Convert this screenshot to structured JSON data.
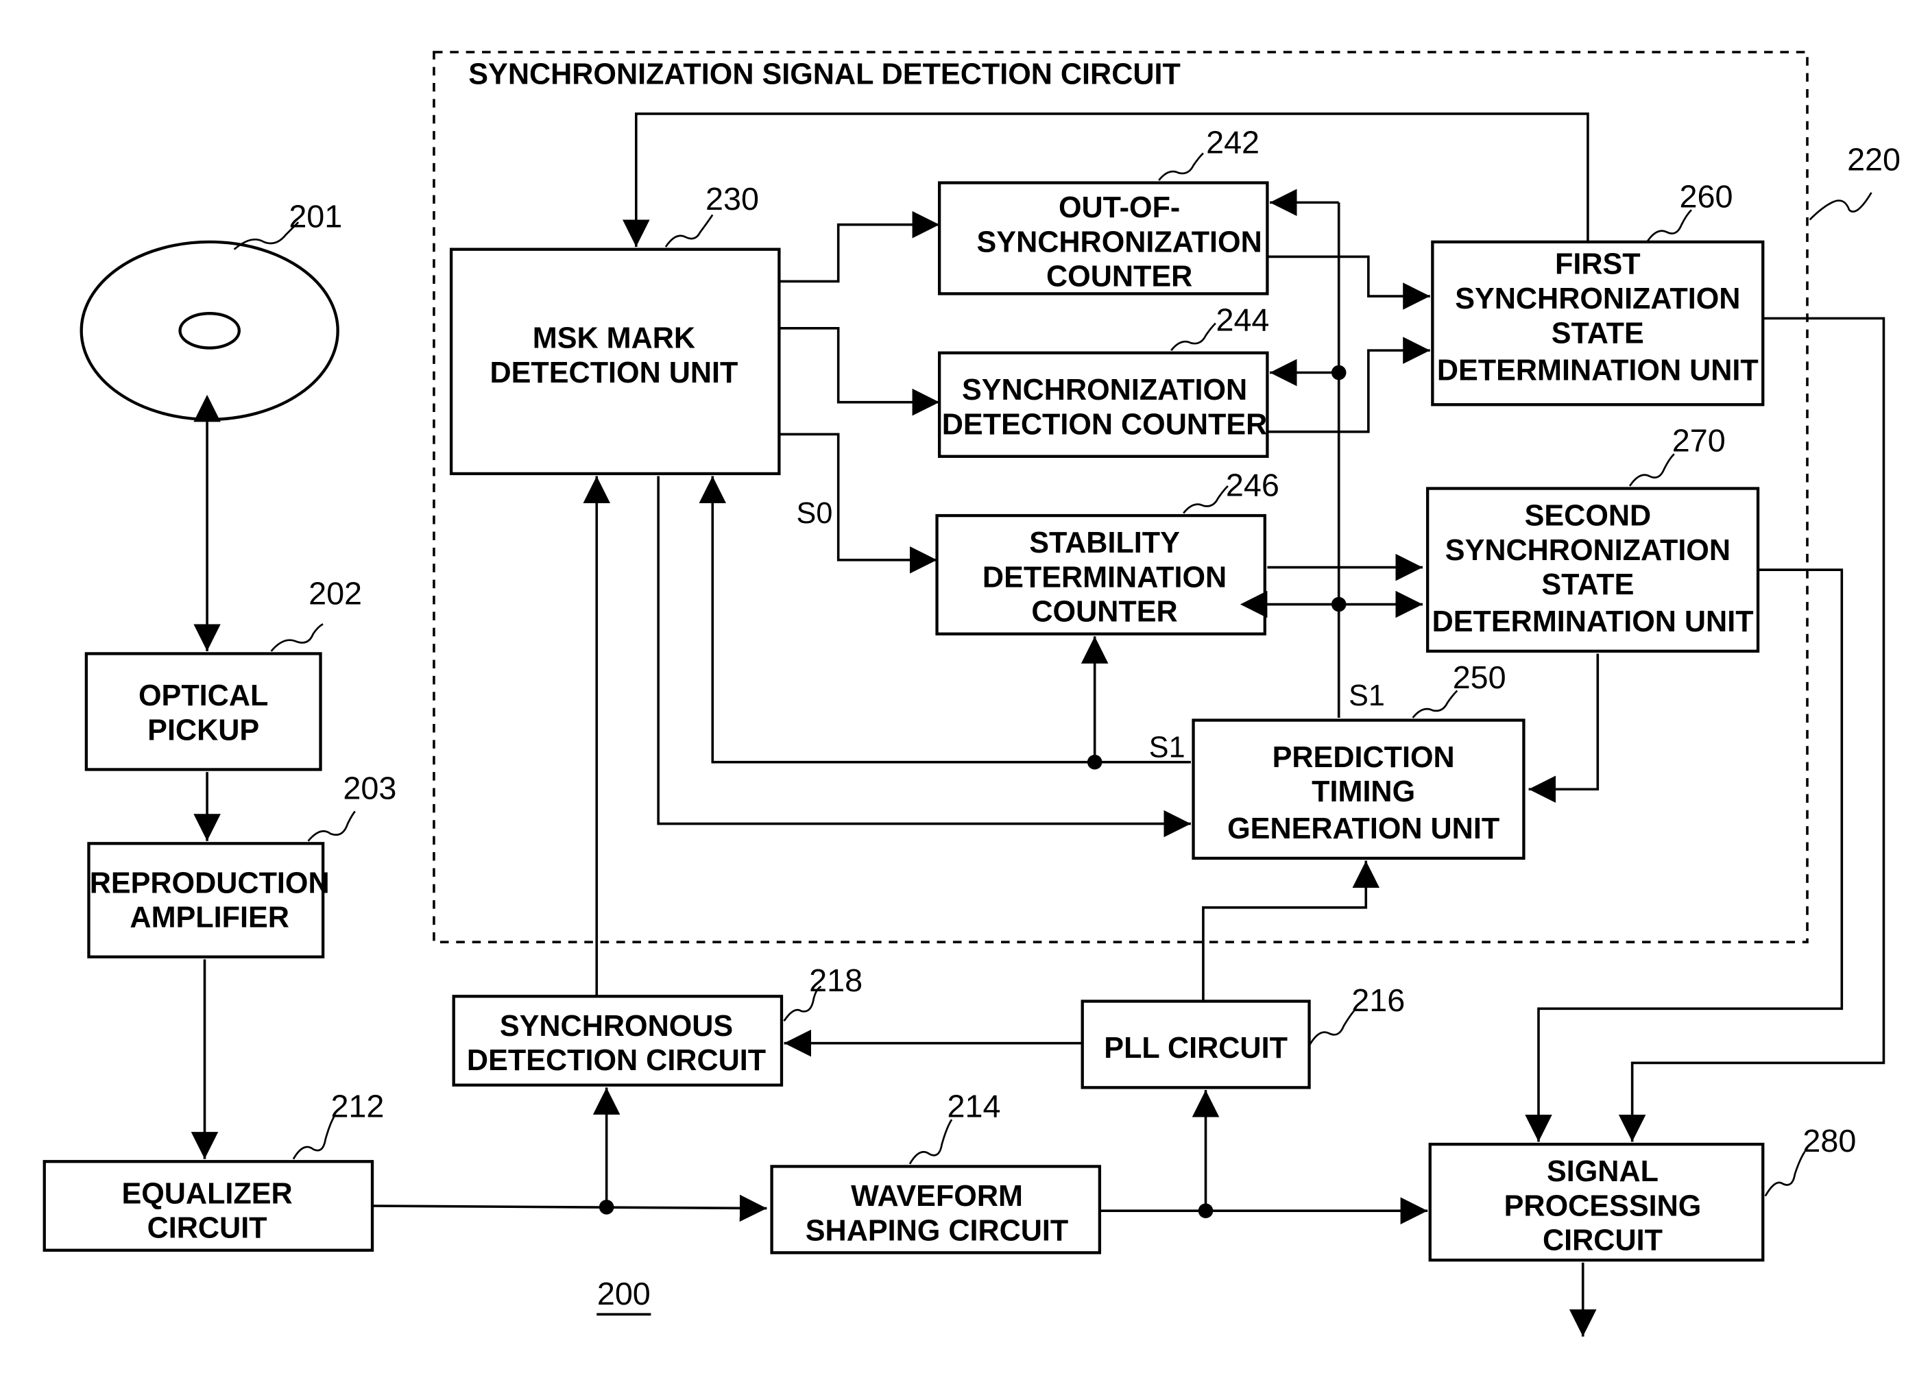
{
  "diagram": {
    "figure_ref": "200",
    "container": {
      "ref": "220",
      "title": "SYNCHRONIZATION SIGNAL DETECTION CIRCUIT"
    },
    "blocks": [
      {
        "id": "disc",
        "ref": "201",
        "lines": []
      },
      {
        "id": "pickup",
        "ref": "202",
        "lines": [
          "OPTICAL",
          "PICKUP"
        ]
      },
      {
        "id": "amp",
        "ref": "203",
        "lines": [
          "REPRODUCTION",
          "AMPLIFIER"
        ]
      },
      {
        "id": "eq",
        "ref": "212",
        "lines": [
          "EQUALIZER",
          "CIRCUIT"
        ]
      },
      {
        "id": "wave",
        "ref": "214",
        "lines": [
          "WAVEFORM",
          "SHAPING CIRCUIT"
        ]
      },
      {
        "id": "pll",
        "ref": "216",
        "lines": [
          "PLL CIRCUIT"
        ]
      },
      {
        "id": "syncdet",
        "ref": "218",
        "lines": [
          "SYNCHRONOUS",
          "DETECTION CIRCUIT"
        ]
      },
      {
        "id": "msk",
        "ref": "230",
        "lines": [
          "MSK MARK",
          "DETECTION UNIT"
        ]
      },
      {
        "id": "oos",
        "ref": "242",
        "lines": [
          "OUT-OF-",
          "SYNCHRONIZATION",
          "COUNTER"
        ]
      },
      {
        "id": "sdc",
        "ref": "244",
        "lines": [
          "SYNCHRONIZATION",
          "DETECTION COUNTER"
        ]
      },
      {
        "id": "stab",
        "ref": "246",
        "lines": [
          "STABILITY",
          "DETERMINATION",
          "COUNTER"
        ]
      },
      {
        "id": "pred",
        "ref": "250",
        "lines": [
          "PREDICTION",
          "TIMING",
          "GENERATION UNIT"
        ]
      },
      {
        "id": "first",
        "ref": "260",
        "lines": [
          "FIRST",
          "SYNCHRONIZATION",
          "STATE",
          "DETERMINATION UNIT"
        ]
      },
      {
        "id": "second",
        "ref": "270",
        "lines": [
          "SECOND",
          "SYNCHRONIZATION",
          "STATE",
          "DETERMINATION UNIT"
        ]
      },
      {
        "id": "sigproc",
        "ref": "280",
        "lines": [
          "SIGNAL",
          "PROCESSING",
          "CIRCUIT"
        ]
      }
    ],
    "signals": {
      "s0": "S0",
      "s1a": "S1",
      "s1b": "S1"
    }
  }
}
